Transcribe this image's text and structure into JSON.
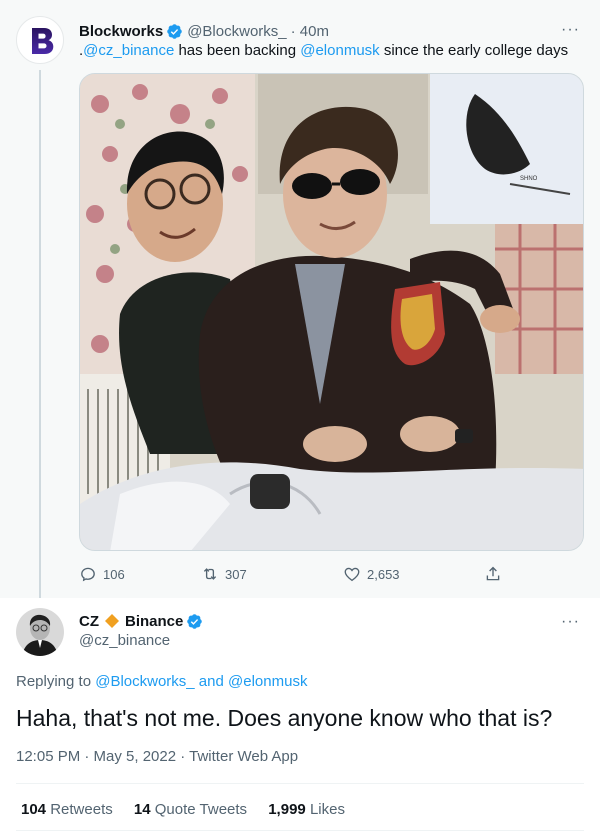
{
  "parent_tweet": {
    "display_name": "Blockworks",
    "handle": "@Blockworks_",
    "time": "· 40m",
    "more": "···",
    "text": {
      "prefix": ".",
      "mention1": "@cz_binance",
      "mid": " has been backing ",
      "mention2": "@elonmusk",
      "suffix": " since the early college days"
    },
    "photo_caption": "SHNO",
    "actions": {
      "replies": "106",
      "retweets": "307",
      "likes": "2,653"
    }
  },
  "reply_tweet": {
    "display_name": "CZ",
    "name_suffix": "Binance",
    "handle": "@cz_binance",
    "more": "···",
    "replying_prefix": "Replying to ",
    "replying_user1": "@Blockworks_",
    "replying_and": " and ",
    "replying_user2": "@elonmusk",
    "text": "Haha, that's not me. Does anyone know who that is?",
    "meta": "12:05 PM · May 5, 2022 · Twitter Web App",
    "stats": {
      "retweets_count": "104",
      "retweets_label": "Retweets",
      "quotes_count": "14",
      "quotes_label": "Quote Tweets",
      "likes_count": "1,999",
      "likes_label": "Likes"
    }
  },
  "colors": {
    "link": "#1d9bf0",
    "muted": "#536471",
    "binance_diamond": "#f0a020",
    "blockworks_logo": "#3b1d8c"
  },
  "icons": [
    "blockworks-logo",
    "verified-badge-icon",
    "more-icon",
    "reply-icon",
    "retweet-icon",
    "like-icon",
    "share-icon",
    "binance-diamond-icon"
  ]
}
